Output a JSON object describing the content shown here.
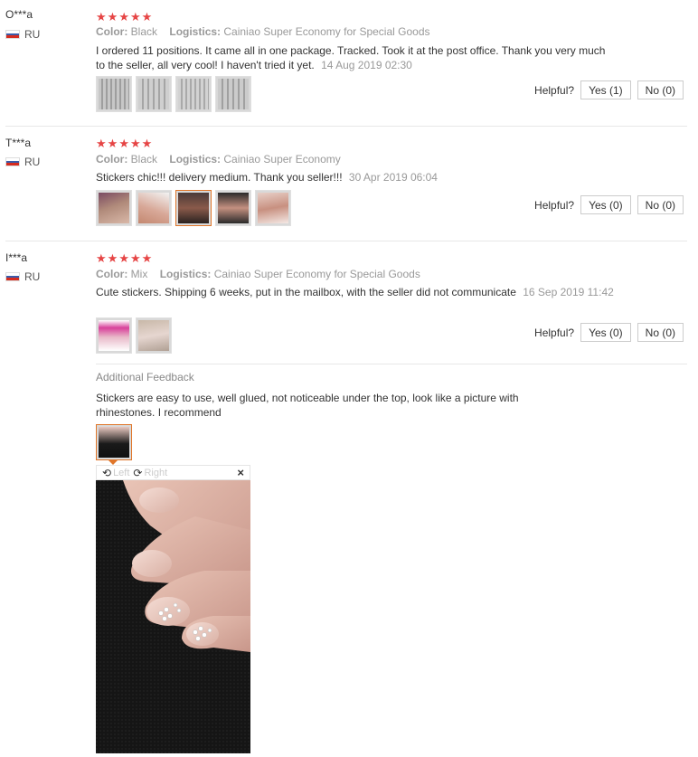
{
  "reviews": [
    {
      "user": "O***a",
      "country": "RU",
      "color_label": "Color:",
      "color": "Black",
      "logistics_label": "Logistics:",
      "logistics": "Cainiao Super Economy for Special Goods",
      "text": "I ordered 11 positions. It came all in one package. Tracked. Took it at the post office. Thank you very much to the seller, all very cool! I haven't tried it yet.",
      "date": "14 Aug 2019 02:30",
      "helpful_label": "Helpful?",
      "yes": "Yes (1)",
      "no": "No (0)"
    },
    {
      "user": "T***a",
      "country": "RU",
      "color_label": "Color:",
      "color": "Black",
      "logistics_label": "Logistics:",
      "logistics": "Cainiao Super Economy",
      "text": "Stickers chic!!! delivery medium. Thank you seller!!!",
      "date": "30 Apr 2019 06:04",
      "helpful_label": "Helpful?",
      "yes": "Yes (0)",
      "no": "No (0)"
    },
    {
      "user": "I***a",
      "country": "RU",
      "color_label": "Color:",
      "color": "Mix",
      "logistics_label": "Logistics:",
      "logistics": "Cainiao Super Economy for Special Goods",
      "text": "Cute stickers. Shipping 6 weeks, put in the mailbox, with the seller did not communicate",
      "date": "16 Sep 2019 11:42",
      "helpful_label": "Helpful?",
      "yes": "Yes (0)",
      "no": "No (0)",
      "additional": {
        "title": "Additional Feedback",
        "text": "Stickers are easy to use, well glued, not noticeable under the top, look like a picture with rhinestones. I recommend"
      }
    }
  ],
  "viewer": {
    "left_label": "Left",
    "right_label": "Right",
    "close": "×"
  },
  "colors": {
    "star": "#e64545",
    "selected_border": "#e0762a",
    "muted": "#999999"
  }
}
